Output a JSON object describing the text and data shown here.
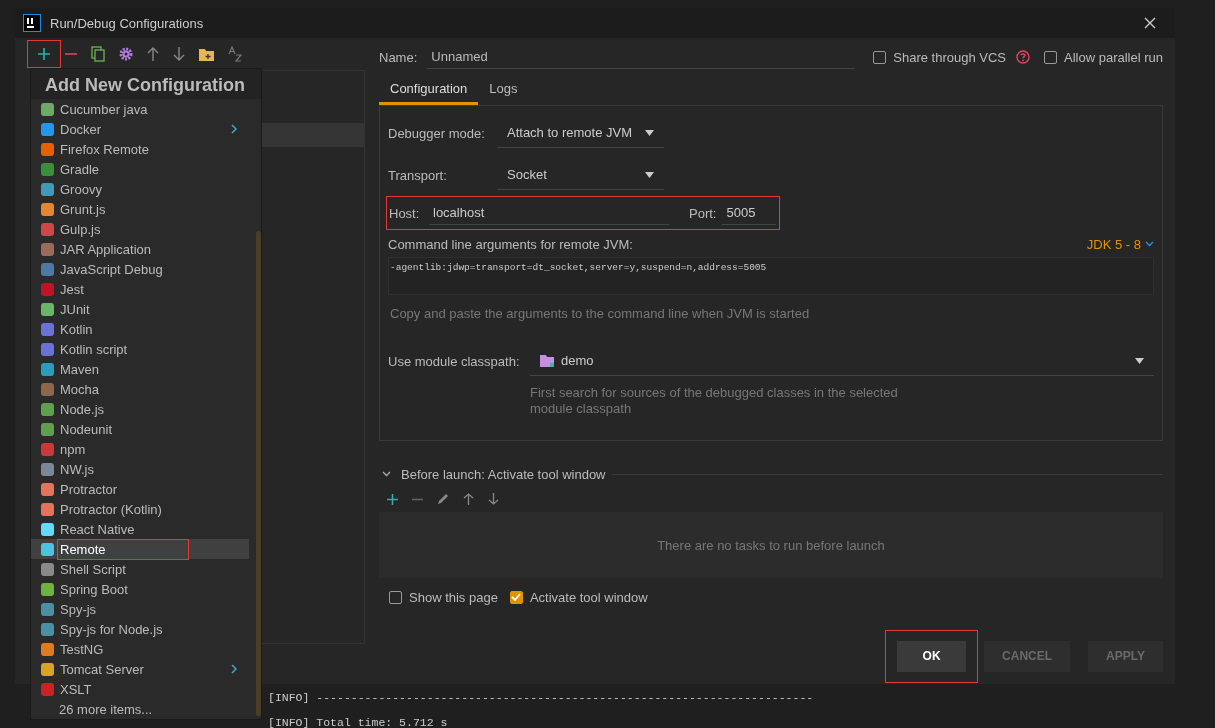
{
  "window": {
    "title": "Run/Debug Configurations"
  },
  "toolbar": {
    "add_highlighted": true
  },
  "popup": {
    "title": "Add New Configuration",
    "more": "26 more items...",
    "items": [
      {
        "label": "Cucumber java",
        "submenu": false,
        "selected": false,
        "highlighted": false
      },
      {
        "label": "Docker",
        "submenu": true,
        "selected": false,
        "highlighted": false
      },
      {
        "label": "Firefox Remote",
        "submenu": false,
        "selected": false,
        "highlighted": false
      },
      {
        "label": "Gradle",
        "submenu": false,
        "selected": false,
        "highlighted": false
      },
      {
        "label": "Groovy",
        "submenu": false,
        "selected": false,
        "highlighted": false
      },
      {
        "label": "Grunt.js",
        "submenu": false,
        "selected": false,
        "highlighted": false
      },
      {
        "label": "Gulp.js",
        "submenu": false,
        "selected": false,
        "highlighted": false
      },
      {
        "label": "JAR Application",
        "submenu": false,
        "selected": false,
        "highlighted": false
      },
      {
        "label": "JavaScript Debug",
        "submenu": false,
        "selected": false,
        "highlighted": false
      },
      {
        "label": "Jest",
        "submenu": false,
        "selected": false,
        "highlighted": false
      },
      {
        "label": "JUnit",
        "submenu": false,
        "selected": false,
        "highlighted": false
      },
      {
        "label": "Kotlin",
        "submenu": false,
        "selected": false,
        "highlighted": false
      },
      {
        "label": "Kotlin script",
        "submenu": false,
        "selected": false,
        "highlighted": false
      },
      {
        "label": "Maven",
        "submenu": false,
        "selected": false,
        "highlighted": false
      },
      {
        "label": "Mocha",
        "submenu": false,
        "selected": false,
        "highlighted": false
      },
      {
        "label": "Node.js",
        "submenu": false,
        "selected": false,
        "highlighted": false
      },
      {
        "label": "Nodeunit",
        "submenu": false,
        "selected": false,
        "highlighted": false
      },
      {
        "label": "npm",
        "submenu": false,
        "selected": false,
        "highlighted": false
      },
      {
        "label": "NW.js",
        "submenu": false,
        "selected": false,
        "highlighted": false
      },
      {
        "label": "Protractor",
        "submenu": false,
        "selected": false,
        "highlighted": false
      },
      {
        "label": "Protractor (Kotlin)",
        "submenu": false,
        "selected": false,
        "highlighted": false
      },
      {
        "label": "React Native",
        "submenu": false,
        "selected": false,
        "highlighted": false
      },
      {
        "label": "Remote",
        "submenu": false,
        "selected": true,
        "highlighted": true
      },
      {
        "label": "Shell Script",
        "submenu": false,
        "selected": false,
        "highlighted": false
      },
      {
        "label": "Spring Boot",
        "submenu": false,
        "selected": false,
        "highlighted": false
      },
      {
        "label": "Spy-js",
        "submenu": false,
        "selected": false,
        "highlighted": false
      },
      {
        "label": "Spy-js for Node.js",
        "submenu": false,
        "selected": false,
        "highlighted": false
      },
      {
        "label": "TestNG",
        "submenu": false,
        "selected": false,
        "highlighted": false
      },
      {
        "label": "Tomcat Server",
        "submenu": true,
        "selected": false,
        "highlighted": false
      },
      {
        "label": "XSLT",
        "submenu": false,
        "selected": false,
        "highlighted": false
      }
    ]
  },
  "name_field": {
    "label": "Name:",
    "value": "Unnamed"
  },
  "share_vcs": {
    "label": "Share through VCS",
    "checked": false
  },
  "allow_parallel": {
    "label": "Allow parallel run",
    "checked": false
  },
  "tabs": [
    {
      "label": "Configuration",
      "selected": true
    },
    {
      "label": "Logs",
      "selected": false
    }
  ],
  "debugger_mode": {
    "label": "Debugger mode:",
    "value": "Attach to remote JVM"
  },
  "transport": {
    "label": "Transport:",
    "value": "Socket"
  },
  "host": {
    "label": "Host:",
    "value": "localhost",
    "highlighted": true
  },
  "port": {
    "label": "Port:",
    "value": "5005"
  },
  "command_line": {
    "label": "Command line arguments for remote JVM:",
    "jdk": "JDK 5 - 8",
    "value": "-agentlib:jdwp=transport=dt_socket,server=y,suspend=n,address=5005",
    "hint": "Copy and paste the arguments to the command line when JVM is started"
  },
  "module_classpath": {
    "label": "Use module classpath:",
    "value": "demo",
    "hint": "First search for sources of the debugged classes in the selected module classpath"
  },
  "before_launch": {
    "title": "Before launch: Activate tool window",
    "expanded": true,
    "empty_text": "There are no tasks to run before launch"
  },
  "show_page": {
    "label": "Show this page",
    "checked": false
  },
  "activate_tool": {
    "label": "Activate tool window",
    "checked": true
  },
  "buttons": [
    {
      "label": "OK",
      "default": true,
      "disabled": false,
      "highlighted": true
    },
    {
      "label": "CANCEL",
      "default": false,
      "disabled": true,
      "highlighted": false
    },
    {
      "label": "APPLY",
      "default": false,
      "disabled": true,
      "highlighted": false
    }
  ],
  "console": [
    "[INFO] ------------------------------------------------------------------------",
    "[INFO] Total time: 5.712 s"
  ]
}
